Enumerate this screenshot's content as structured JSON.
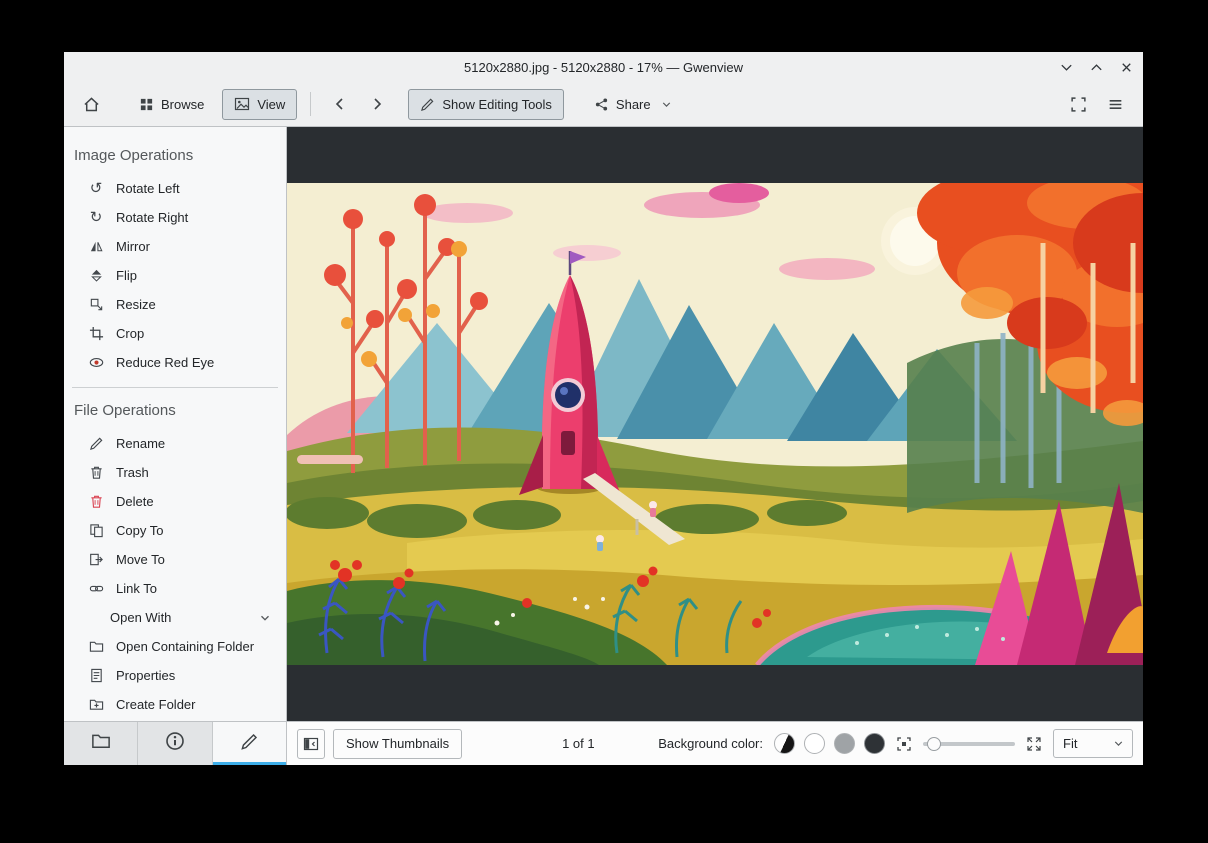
{
  "window": {
    "title": "5120x2880.jpg - 5120x2880 - 17% — Gwenview",
    "controls": {
      "minimize": "minimize",
      "maximize": "maximize",
      "close": "close"
    }
  },
  "toolbar": {
    "home": {
      "icon": "home-icon"
    },
    "browse": {
      "label": "Browse",
      "icon": "browse-grid-icon",
      "active": false
    },
    "view": {
      "label": "View",
      "icon": "image-view-icon",
      "active": true
    },
    "back": {
      "icon": "back-chevron-icon"
    },
    "forward": {
      "icon": "forward-chevron-icon"
    },
    "editing_tools": {
      "label": "Show Editing Tools",
      "icon": "pencil-icon",
      "active": true
    },
    "share": {
      "label": "Share",
      "icon": "share-icon",
      "has_dropdown": true
    },
    "fullscreen": {
      "icon": "zoom-fit-best-icon"
    },
    "menu": {
      "icon": "hamburger-icon"
    }
  },
  "sidebar": {
    "sections": [
      {
        "title": "Image Operations",
        "items": [
          {
            "label": "Rotate Left",
            "icon": "rotate-left-icon"
          },
          {
            "label": "Rotate Right",
            "icon": "rotate-right-icon"
          },
          {
            "label": "Mirror",
            "icon": "mirror-icon"
          },
          {
            "label": "Flip",
            "icon": "flip-icon"
          },
          {
            "label": "Resize",
            "icon": "resize-icon"
          },
          {
            "label": "Crop",
            "icon": "crop-icon"
          },
          {
            "label": "Reduce Red Eye",
            "icon": "reduce-red-eye-icon"
          }
        ]
      },
      {
        "title": "File Operations",
        "items": [
          {
            "label": "Rename",
            "icon": "rename-icon"
          },
          {
            "label": "Trash",
            "icon": "trash-icon"
          },
          {
            "label": "Delete",
            "icon": "delete-icon"
          },
          {
            "label": "Copy To",
            "icon": "copy-to-icon"
          },
          {
            "label": "Move To",
            "icon": "move-to-icon"
          },
          {
            "label": "Link To",
            "icon": "link-to-icon"
          },
          {
            "label": "Open With",
            "icon": "chevron-down-icon",
            "submenu": true
          },
          {
            "label": "Open Containing Folder",
            "icon": "folder-icon"
          },
          {
            "label": "Properties",
            "icon": "properties-icon"
          },
          {
            "label": "Create Folder",
            "icon": "create-folder-icon"
          }
        ]
      }
    ],
    "tabs": [
      {
        "name": "folders",
        "icon": "folder-tab-icon",
        "active": false
      },
      {
        "name": "information",
        "icon": "info-tab-icon",
        "active": false
      },
      {
        "name": "operations",
        "icon": "pencil-tab-icon",
        "active": true
      }
    ]
  },
  "statusbar": {
    "show_thumbnails_label": "Show Thumbnails",
    "page_indicator": "1 of 1",
    "background_color_label": "Background color:",
    "background_swatches": [
      {
        "name": "auto-split",
        "style": "half-light-half-dark"
      },
      {
        "name": "white",
        "color": "#ffffff"
      },
      {
        "name": "gray",
        "color": "#9fa3a6"
      },
      {
        "name": "dark",
        "color": "#2e3236",
        "selected": true
      }
    ],
    "zoom_mode": "Fit"
  },
  "colors": {
    "accent": "#3daee9",
    "viewer_background": "#2a2e32",
    "chrome_background": "#eff0f1",
    "delete_red": "#da4453"
  }
}
